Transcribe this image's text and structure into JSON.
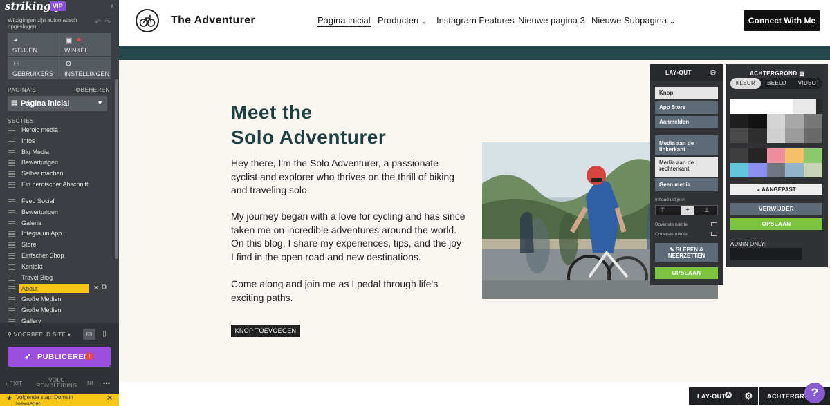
{
  "editor": {
    "brand": "strikingly",
    "vip_badge": "VIP",
    "autosave_note": "Wijzigingen zijn automatisch opgeslagen",
    "tiles": [
      {
        "label": "STIJLEN",
        "icon": "palette-icon"
      },
      {
        "label": "WINKEL",
        "icon": "shopping-bag-icon"
      },
      {
        "label": "GEBRUIKERS",
        "icon": "users-icon"
      },
      {
        "label": "INSTELLINGEN",
        "icon": "gear-icon"
      }
    ],
    "pages_label": "PAGINA'S",
    "manage_label": "BEHEREN",
    "current_page": "Página inicial",
    "sections_label": "SECTIES",
    "sections": [
      "Heroic media",
      "Infos",
      "Big Media",
      "Bewertungen",
      "Selber machen",
      "Ein heroischer Abschnitt",
      "Feed Social",
      "Bewertungen",
      "Galeria",
      "Integra un'App",
      "Store",
      "Einfacher Shop",
      "Kontakt",
      "Travel Blog",
      "About",
      "Große Medien",
      "Große Medien",
      "Gallery"
    ],
    "selected_section": "About",
    "preview_label": "VOORBEELD SITE",
    "publish_label": "PUBLICEREN",
    "publish_alert": "!",
    "footer": {
      "exit": "EXIT",
      "guide": "VOLG RONDLEIDING",
      "lang": "NL",
      "more": "•••"
    },
    "next_step": "Volgende stap: Domein toevoegen"
  },
  "site": {
    "title": "The Adventurer",
    "nav": [
      "Página inicial",
      "Producten",
      "Instagram Features",
      "Nieuwe pagina 3",
      "Nieuwe Subpagina"
    ],
    "cta": "Connect With Me"
  },
  "about": {
    "heading_line1": "Meet the",
    "heading_line2": "Solo Adventurer",
    "p1": "Hey there, I'm the Solo Adventurer, a passionate cyclist and explorer who thrives on the thrill of biking and traveling solo.",
    "p2": "My journey began with a love for cycling and has since taken me on incredible adventures around the world. On this blog, I share my experiences, tips, and the joy I find in the open road and new destinations.",
    "p3": "Come along and join me as I pedal through life's exciting paths.",
    "add_button": "KNOP TOEVOEGEN"
  },
  "layout_panel": {
    "title": "LAY-OUT",
    "options": [
      "Knop",
      "App Store",
      "Aanmelden"
    ],
    "media_options": [
      "Media aan de linkerkant",
      "Media aan de rechterkant",
      "Geen media"
    ],
    "align_label": "Inhoud uitlijnen",
    "top_space": "Bovenste ruimte",
    "bottom_space": "Onderste ruimte",
    "drag_label": "SLEPEN & NEERZETTEN",
    "save": "OPSLAAN"
  },
  "background_panel": {
    "title": "ACHTERGROND",
    "tabs": [
      "KLEUR",
      "BEELD",
      "VIDEO"
    ],
    "swatches": [
      "#ffffff",
      "#ffffff",
      "#e8e8e8",
      "#e8e8e8",
      "#2a2a2a",
      "#1f1f1f",
      "#121212",
      "#d4d4d4",
      "#a9a9a9",
      "#777777",
      "#4a4a4a",
      "#2e2e2e",
      "#cfcfcf",
      "#9c9c9c",
      "#6a6a6a",
      "#3e3e3e",
      "#252525",
      "#ef8e9b",
      "#f6c06b",
      "#8ac96d",
      "#63c5dc",
      "#8a8ff0",
      "#707782",
      "#93b3c8",
      "#c8d3b8",
      "#b9c6b5",
      "#d3bcc6"
    ],
    "custom": "AANGEPAST",
    "delete": "VERWIJDER",
    "save": "OPSLAAN",
    "admin_only": "ADMIN ONLY:"
  },
  "bottom_bar": {
    "layout": "LAY-OUT",
    "background": "ACHTERGROND"
  },
  "help": "?"
}
